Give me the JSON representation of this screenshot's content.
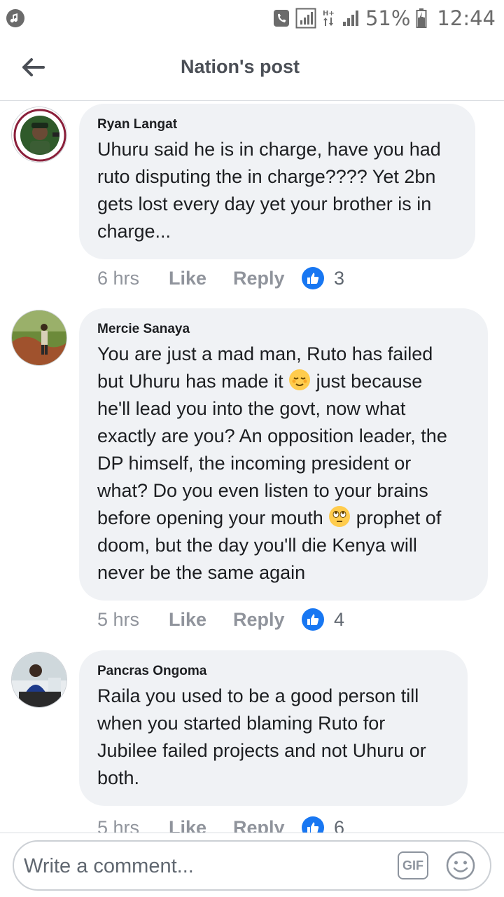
{
  "status_bar": {
    "battery_percent": "51%",
    "time": "12:44",
    "network": "H+"
  },
  "header": {
    "title": "Nation's post"
  },
  "comments": [
    {
      "author": "Ryan Langat",
      "text": "Uhuru said he is in charge, have you had\nruto disputing the in charge???? Yet 2bn\ngets lost every day yet your brother is in\ncharge...",
      "time": "6 hrs",
      "like_label": "Like",
      "reply_label": "Reply",
      "likes": "3"
    },
    {
      "author": "Mercie Sanaya",
      "text_part1": "You are just a mad man, Ruto has failed\nbut Uhuru has made it ",
      "text_part2": " just because\nhe'll lead you into the govt, now what\nexactly are you? An opposition leader, the\nDP himself, the incoming president or\nwhat? Do you even listen to your brains\nbefore opening your mouth ",
      "text_part3": " prophet of\ndoom, but the day you'll die Kenya will\nnever be the same again",
      "time": "5 hrs",
      "like_label": "Like",
      "reply_label": "Reply",
      "likes": "4"
    },
    {
      "author": "Pancras Ongoma",
      "text": "Raila you used to be a good person till\nwhen you started blaming Ruto for\nJubilee failed projects and not Uhuru or\nboth.",
      "time": "5 hrs",
      "like_label": "Like",
      "reply_label": "Reply",
      "likes": "6"
    }
  ],
  "composer": {
    "placeholder": "Write a comment...",
    "gif_label": "GIF"
  },
  "colors": {
    "like_blue": "#1877f2",
    "bubble_bg": "#f0f2f5",
    "meta_gray": "#90949c"
  }
}
